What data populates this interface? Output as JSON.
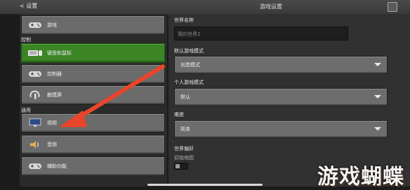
{
  "header": {
    "back_label": "< 设置",
    "title": "游戏设置"
  },
  "sidebar": {
    "top_item": {
      "label": "游戏",
      "icon": "controller-icon"
    },
    "sections": [
      {
        "label": "控制"
      },
      {
        "label": "通用"
      }
    ],
    "items": [
      {
        "label": "键盘和鼠标",
        "icon": "keyboard-icon",
        "active": true
      },
      {
        "label": "控制器",
        "icon": "controller-icon",
        "active": false
      },
      {
        "label": "触摸屏",
        "icon": "touch-icon",
        "active": false
      },
      {
        "label": "视频",
        "icon": "monitor-icon",
        "active": false
      },
      {
        "label": "音频",
        "icon": "speaker-icon",
        "active": false
      },
      {
        "label": "辅助功能",
        "icon": "controller-icon",
        "active": false
      }
    ]
  },
  "main": {
    "world_name_label": "世界名称",
    "world_name_value": "我的世界2",
    "default_mode_label": "默认游戏模式",
    "default_mode_value": "创造模式",
    "personal_mode_label": "个人游戏模式",
    "personal_mode_value": "默认",
    "difficulty_label": "难度",
    "difficulty_value": "简单",
    "world_prefs_label": "世界偏好",
    "initial_map_label": "初始地图"
  },
  "watermark": "游戏蝴蝶",
  "colors": {
    "active_green": "#3c8527",
    "annotation_arrow": "#e8452a"
  }
}
